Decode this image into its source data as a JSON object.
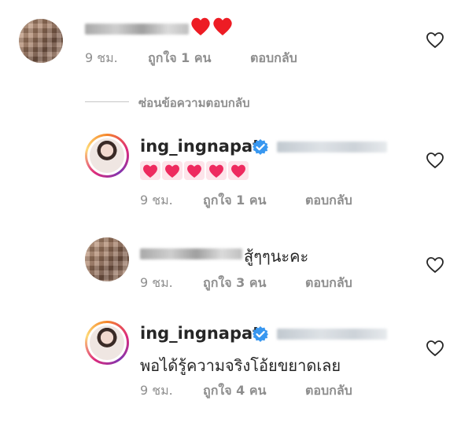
{
  "comments": [
    {
      "text": "♥♥",
      "time": "9 ชม.",
      "likes": "ถูกใจ 1 คน",
      "reply": "ตอบกลับ"
    }
  ],
  "hide_replies": "ซ่อนข้อความตอบกลับ",
  "replies": [
    {
      "username": "ing_ingnapat",
      "text": "💖💖💖💖💖",
      "time": "9 ชม.",
      "likes": "ถูกใจ 1 คน",
      "reply": "ตอบกลับ"
    },
    {
      "text": "สู้ๆๆนะคะ",
      "time": "9 ชม.",
      "likes": "ถูกใจ 3 คน",
      "reply": "ตอบกลับ"
    },
    {
      "username": "ing_ingnapat",
      "text": "พอได้รู้ความจริงโอ้ยขยาดเลย",
      "time": "9 ชม.",
      "likes": "ถูกใจ 4 คน",
      "reply": "ตอบกลับ"
    }
  ],
  "colors": {
    "text": "#262626",
    "meta": "#8e8e8e",
    "verified": "#3897f0",
    "heart": "#ed1c24"
  }
}
